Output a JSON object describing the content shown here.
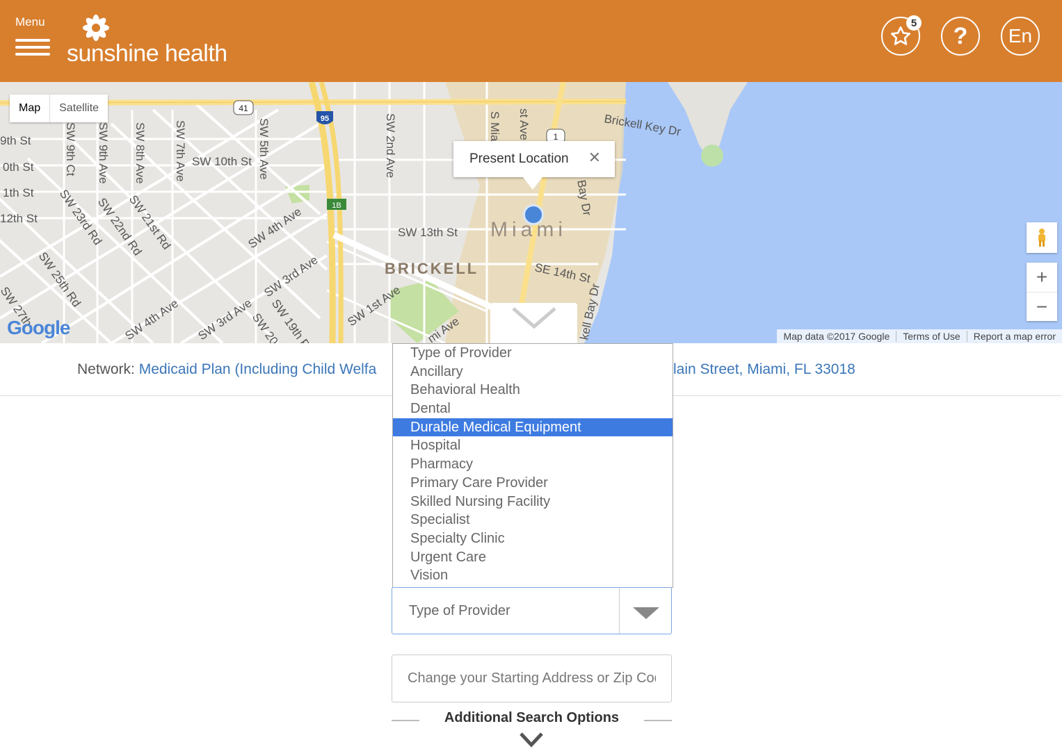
{
  "header": {
    "menu_label": "Menu",
    "brand": "sunshine health",
    "favorites_count": "5",
    "help_label": "?",
    "language_label": "En",
    "bg_color": "#d87f2e"
  },
  "map": {
    "toggle": {
      "map": "Map",
      "satellite": "Satellite"
    },
    "info_window": {
      "title": "Present Location",
      "close": "✕"
    },
    "zoom_in": "+",
    "zoom_out": "−",
    "google": "Google",
    "attribution": [
      "Map data ©2017 Google",
      "Terms of Use",
      "Report a map error"
    ],
    "labels": {
      "brickell": "BRICKELL",
      "miami": "Miami",
      "sw_13th": "SW 13th St",
      "se_14th": "SE 14th St",
      "sw_10th": "SW 10th St",
      "brickell_key": "Brickell Key Dr",
      "sw_4th_ave": "SW 4th Ave",
      "sw_3rd_ave": "SW 3rd Ave",
      "sw_1st_ave": "SW 1st Ave",
      "sw_2nd_ave": "SW 2nd Ave",
      "sw_5th_ave": "SW 5th Ave",
      "sw_7th_ave": "SW 7th Ave",
      "sw_8th_ave": "SW 8th Ave",
      "sw_9th_ave": "SW 9th Ave",
      "sw_9th_ct": "SW 9th Ct",
      "st_9th": "9th St",
      "st_10th": "0th St",
      "st_11th": "1th St",
      "st_12th": "12th St",
      "sw_21st_rd": "SW 21st Rd",
      "sw_22nd_rd": "SW 22nd Rd",
      "sw_23rd_rd": "SW 23rd Rd",
      "sw_25th_rd": "SW 25th Rd",
      "sw_27th": "SW 27th",
      "sw_19th": "SW 19th P",
      "sw_20": "SW 20",
      "sw_4th_ave_b": "SW 4th Ave",
      "route_41": "41",
      "route_95": "95",
      "route_1": "1",
      "exit_1b": "1B",
      "bay_dr": "ll Bay Dr",
      "bay_dr2": "kell Bay Dr",
      "mi_ave": "mi Ave",
      "s_mia": "S Mia",
      "st_ave": "st Ave"
    }
  },
  "network": {
    "label": "Network:",
    "plan": "Medicaid Plan (Including Child Welfa",
    "address": "lain Street, Miami, FL 33018"
  },
  "provider_options": [
    "Type of Provider",
    "Ancillary",
    "Behavioral Health",
    "Dental",
    "Durable Medical Equipment",
    "Hospital",
    "Pharmacy",
    "Primary Care Provider",
    "Skilled Nursing Facility",
    "Specialist",
    "Specialty Clinic",
    "Urgent Care",
    "Vision"
  ],
  "highlighted_option": "Durable Medical Equipment",
  "select": {
    "value": "Type of Provider"
  },
  "address_input": {
    "placeholder": "Change your Starting Address or Zip Code"
  },
  "additional_search": "Additional Search Options"
}
